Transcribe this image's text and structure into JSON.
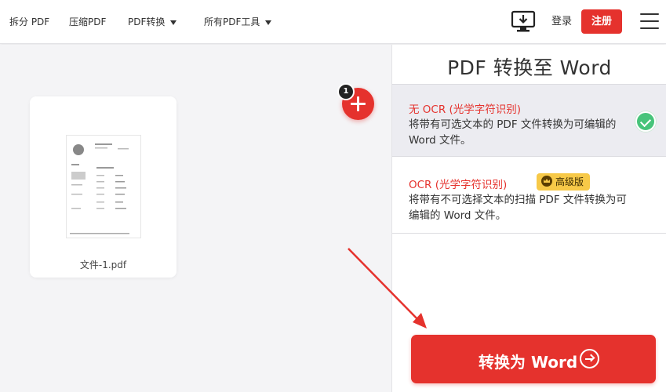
{
  "nav": {
    "split": "拆分 PDF",
    "compress": "压缩PDF",
    "convert": "PDF转换",
    "all_tools": "所有PDF工具",
    "login": "登录",
    "register": "注册"
  },
  "workspace": {
    "file_count": "1",
    "file_name": "文件-1.pdf"
  },
  "panel": {
    "title": "PDF 转换至 Word",
    "options": [
      {
        "title": "无 OCR (光学字符识别)",
        "desc": "将带有可选文本的 PDF 文件转换为可编辑的 Word 文件。",
        "selected": true
      },
      {
        "title": "OCR (光学字符识别)",
        "desc": "将带有不可选择文本的扫描 PDF 文件转换为可编辑的 Word 文件。",
        "badge": "高级版",
        "selected": false
      }
    ],
    "convert_button": "转换为 Word"
  },
  "colors": {
    "accent": "#e5322d",
    "check": "#47c47a",
    "premium": "#f7c948"
  }
}
